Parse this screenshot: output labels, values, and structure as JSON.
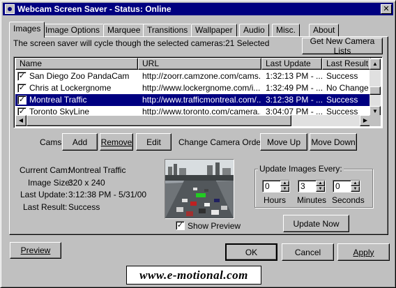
{
  "window": {
    "title": "Webcam Screen Saver - Status: Online",
    "close_glyph": "✕"
  },
  "tabs": [
    {
      "label": "Images",
      "active": true
    },
    {
      "label": "Image Options"
    },
    {
      "label": "Marquee"
    },
    {
      "label": "Transitions"
    },
    {
      "label": "Wallpaper"
    },
    {
      "label": "Audio"
    },
    {
      "label": "Misc."
    },
    {
      "label": "About"
    }
  ],
  "images_tab": {
    "summary_text": "The screen saver will cycle though the selected cameras:",
    "selected_count": "21 Selected",
    "get_new_lists_label": "Get New Camera Lists",
    "columns": [
      "Name",
      "URL",
      "Last Update",
      "Last Result"
    ],
    "rows": [
      {
        "checked": true,
        "name": "San Diego Zoo PandaCam",
        "url": "http://zoorr.camzone.com/cams...",
        "last_update": "1:32:13 PM - ...",
        "last_result": "Success",
        "selected": false
      },
      {
        "checked": true,
        "name": "Chris at Lockergnome",
        "url": "http://www.lockergnome.com/i...",
        "last_update": "1:32:49 PM - ...",
        "last_result": "No Change",
        "selected": false
      },
      {
        "checked": true,
        "name": "Montreal Traffic",
        "url": "http://www.trafficmontreal.com/...",
        "last_update": "3:12:38 PM - ...",
        "last_result": "Success",
        "selected": true
      },
      {
        "checked": true,
        "name": "Toronto SkyLine",
        "url": "http://www.toronto.com/camera...",
        "last_update": "3:04:07 PM - ...",
        "last_result": "Success",
        "selected": false
      }
    ],
    "cams_label": "Cams:",
    "add_label": "Add",
    "remove_label": "Remove",
    "edit_label": "Edit",
    "change_order_label": "Change Camera Order:",
    "move_up_label": "Move Up",
    "move_down_label": "Move Down",
    "info": {
      "current_cam_label": "Current Cam:",
      "current_cam_value": "Montreal Traffic",
      "image_size_label": "Image Size:",
      "image_size_value": "320 x 240",
      "last_update_label": "Last Update:",
      "last_update_value": "3:12:38 PM - 5/31/00",
      "last_result_label": "Last Result:",
      "last_result_value": "Success"
    },
    "show_preview_label": "Show Preview",
    "show_preview_checked": true,
    "update_group_label": "Update Images Every:",
    "hours_value": "0",
    "minutes_value": "3",
    "seconds_value": "0",
    "hours_label": "Hours",
    "minutes_label": "Minutes",
    "seconds_label": "Seconds",
    "update_now_label": "Update Now"
  },
  "footer": {
    "preview_label": "Preview",
    "ok_label": "OK",
    "cancel_label": "Cancel",
    "apply_label": "Apply"
  },
  "logo_text": "www.e-motional.com",
  "icons": {
    "check": "✓",
    "up_arrow": "▲",
    "down_arrow": "▼",
    "left_arrow": "◀",
    "right_arrow": "▶"
  },
  "colors": {
    "title_bar": "#000080",
    "face": "#c0c0c0",
    "selection": "#000080"
  }
}
